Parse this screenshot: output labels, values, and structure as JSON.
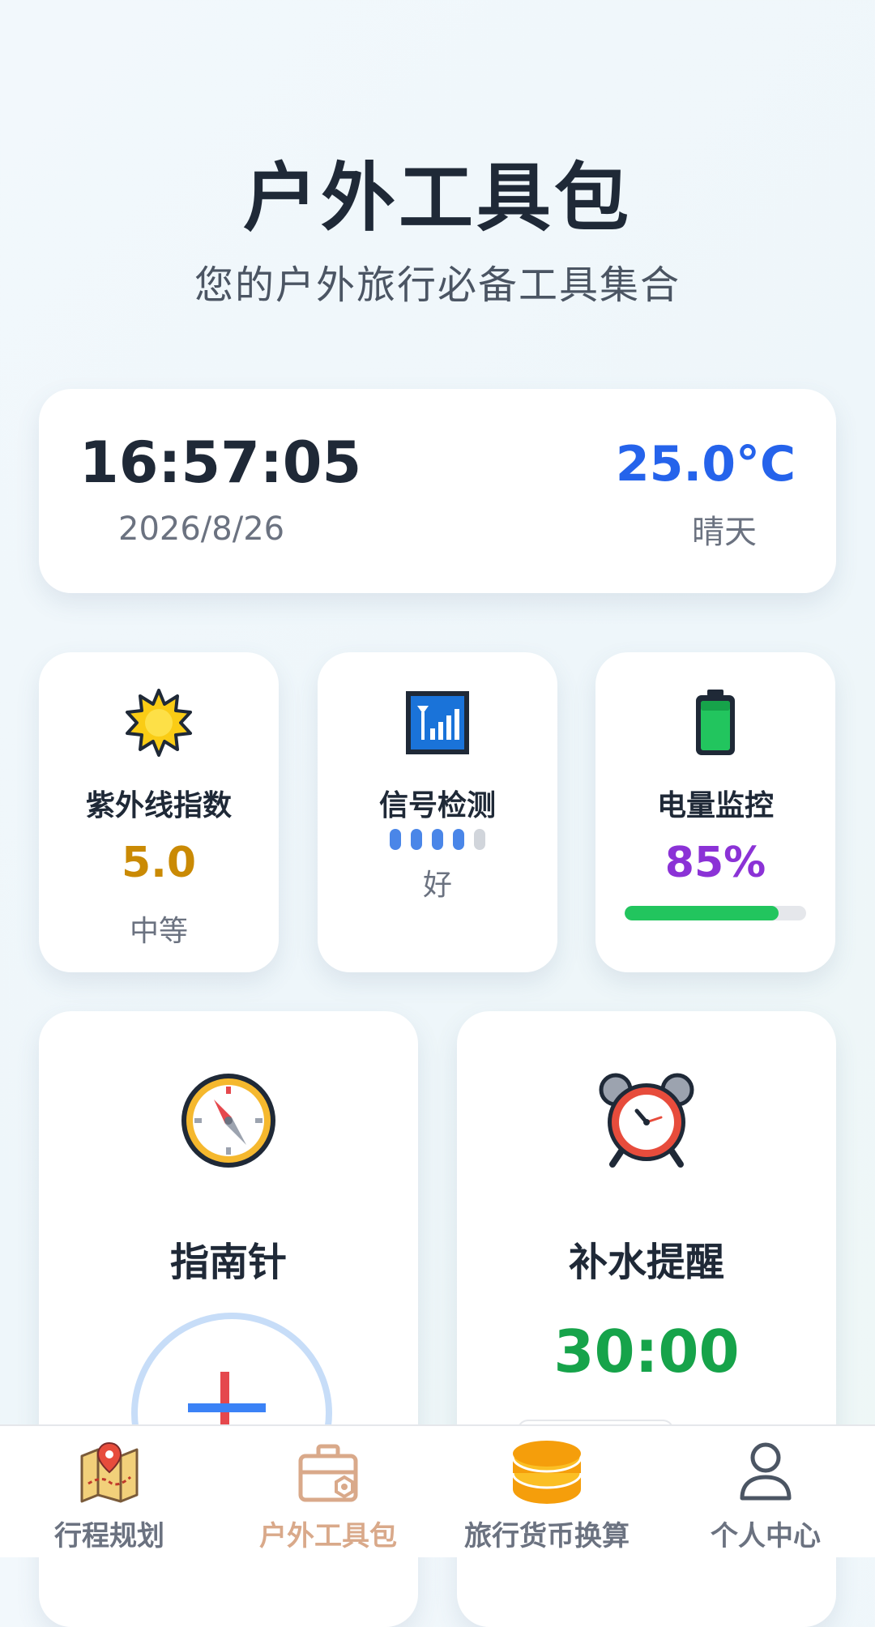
{
  "header": {
    "title": "户外工具包",
    "subtitle": "您的户外旅行必备工具集合"
  },
  "info": {
    "time": "16:57:05",
    "date": "2026/8/26",
    "temperature": "25.0°C",
    "weather": "晴天"
  },
  "uv": {
    "icon": "sun-icon",
    "label": "紫外线指数",
    "value": "5.0",
    "level": "中等"
  },
  "signal": {
    "icon": "signal-icon",
    "label": "信号检测",
    "bars_active": 4,
    "bars_total": 5,
    "status": "好"
  },
  "battery": {
    "icon": "battery-icon",
    "label": "电量监控",
    "value": "85%",
    "level_percent": 85
  },
  "compass": {
    "icon": "compass-icon",
    "label": "指南针"
  },
  "water": {
    "icon": "alarm-clock-icon",
    "label": "补水提醒",
    "timer": "30:00"
  },
  "nav": {
    "items": [
      {
        "label": "行程规划",
        "icon": "map-icon",
        "active": false
      },
      {
        "label": "户外工具包",
        "icon": "toolbox-icon",
        "active": true
      },
      {
        "label": "旅行货币换算",
        "icon": "coins-icon",
        "active": false
      },
      {
        "label": "个人中心",
        "icon": "user-icon",
        "active": false
      }
    ]
  },
  "colors": {
    "accent_blue": "#2563eb",
    "uv_yellow": "#ca8a04",
    "battery_purple": "#8b32d6",
    "battery_green": "#22c55e",
    "timer_green": "#16a34a",
    "nav_active": "#d9a98a"
  }
}
